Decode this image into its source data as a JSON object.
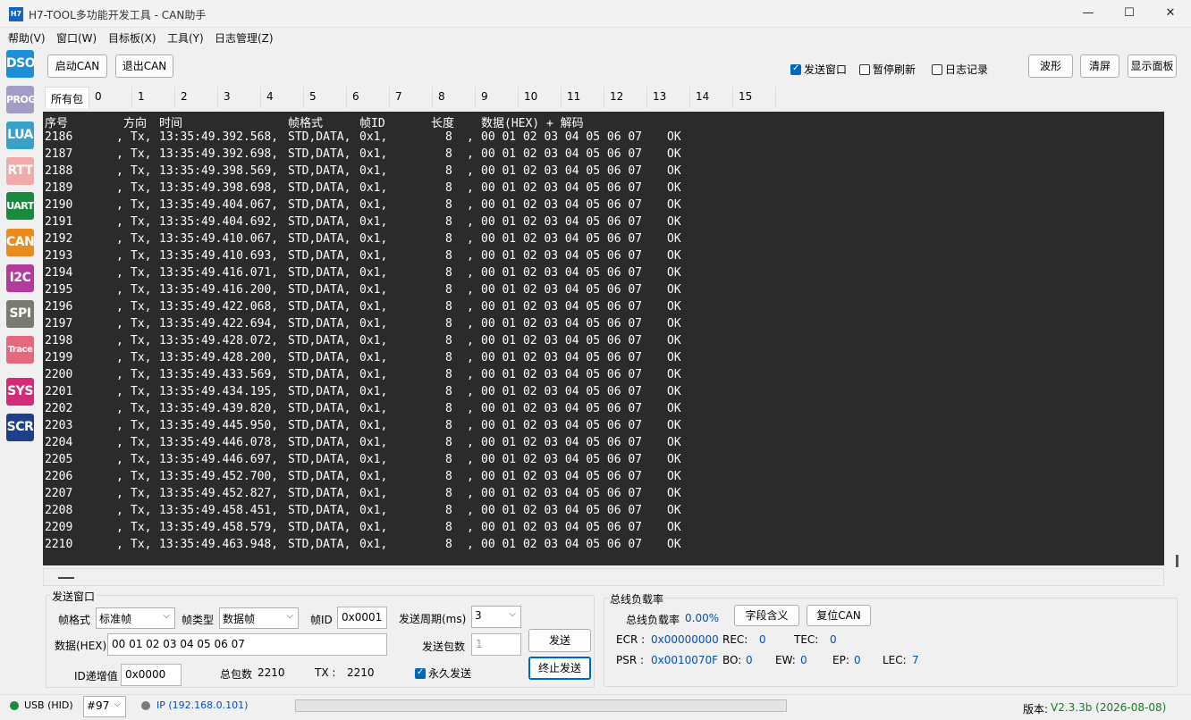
{
  "window": {
    "icon_text": "H7",
    "title": "H7-TOOL多功能开发工具 - CAN助手",
    "minimize": "—",
    "maximize": "☐",
    "close": "✕"
  },
  "menu": [
    "帮助(V)",
    "窗口(W)",
    "目标板(X)",
    "工具(Y)",
    "日志管理(Z)"
  ],
  "sidebar": [
    {
      "label": "DSO",
      "color": "#1e8fd6"
    },
    {
      "label": "PROG",
      "color": "#a59cc6"
    },
    {
      "label": "LUA",
      "color": "#3aa0c8"
    },
    {
      "label": "RTT",
      "color": "#f1a9a9"
    },
    {
      "label": "UART",
      "color": "#1a8a3e"
    },
    {
      "label": "CAN",
      "color": "#e98c1d"
    },
    {
      "label": "I2C",
      "color": "#b43a9b"
    },
    {
      "label": "SPI",
      "color": "#7a7a72"
    },
    {
      "label": "Trace",
      "color": "#e26a7c"
    },
    {
      "label": "SYS",
      "color": "#d42a7a"
    },
    {
      "label": "SCR",
      "color": "#1e3f8a"
    }
  ],
  "toolbar": {
    "start_can": "启动CAN",
    "exit_can": "退出CAN",
    "send_window": {
      "label": "发送窗口",
      "checked": true
    },
    "pause_refresh": {
      "label": "暂停刷新",
      "checked": false
    },
    "log_record": {
      "label": "日志记录",
      "checked": false
    },
    "waveform": "波形",
    "clear": "清屏",
    "show_panel": "显示面板"
  },
  "tabs": [
    "所有包",
    "0",
    "1",
    "2",
    "3",
    "4",
    "5",
    "6",
    "7",
    "8",
    "9",
    "10",
    "11",
    "12",
    "13",
    "14",
    "15"
  ],
  "log": {
    "header": [
      "序号",
      "方向",
      "时间",
      "帧格式",
      "帧ID",
      "长度",
      "数据(HEX) + 解码"
    ],
    "rows": [
      [
        "2186",
        ",",
        "Tx,",
        "13:35:49.392.568,",
        "STD,DATA,",
        "0x1,",
        "8",
        ",",
        "00 01 02 03 04 05 06 07",
        "OK"
      ],
      [
        "2187",
        ",",
        "Tx,",
        "13:35:49.392.698,",
        "STD,DATA,",
        "0x1,",
        "8",
        ",",
        "00 01 02 03 04 05 06 07",
        "OK"
      ],
      [
        "2188",
        ",",
        "Tx,",
        "13:35:49.398.569,",
        "STD,DATA,",
        "0x1,",
        "8",
        ",",
        "00 01 02 03 04 05 06 07",
        "OK"
      ],
      [
        "2189",
        ",",
        "Tx,",
        "13:35:49.398.698,",
        "STD,DATA,",
        "0x1,",
        "8",
        ",",
        "00 01 02 03 04 05 06 07",
        "OK"
      ],
      [
        "2190",
        ",",
        "Tx,",
        "13:35:49.404.067,",
        "STD,DATA,",
        "0x1,",
        "8",
        ",",
        "00 01 02 03 04 05 06 07",
        "OK"
      ],
      [
        "2191",
        ",",
        "Tx,",
        "13:35:49.404.692,",
        "STD,DATA,",
        "0x1,",
        "8",
        ",",
        "00 01 02 03 04 05 06 07",
        "OK"
      ],
      [
        "2192",
        ",",
        "Tx,",
        "13:35:49.410.067,",
        "STD,DATA,",
        "0x1,",
        "8",
        ",",
        "00 01 02 03 04 05 06 07",
        "OK"
      ],
      [
        "2193",
        ",",
        "Tx,",
        "13:35:49.410.693,",
        "STD,DATA,",
        "0x1,",
        "8",
        ",",
        "00 01 02 03 04 05 06 07",
        "OK"
      ],
      [
        "2194",
        ",",
        "Tx,",
        "13:35:49.416.071,",
        "STD,DATA,",
        "0x1,",
        "8",
        ",",
        "00 01 02 03 04 05 06 07",
        "OK"
      ],
      [
        "2195",
        ",",
        "Tx,",
        "13:35:49.416.200,",
        "STD,DATA,",
        "0x1,",
        "8",
        ",",
        "00 01 02 03 04 05 06 07",
        "OK"
      ],
      [
        "2196",
        ",",
        "Tx,",
        "13:35:49.422.068,",
        "STD,DATA,",
        "0x1,",
        "8",
        ",",
        "00 01 02 03 04 05 06 07",
        "OK"
      ],
      [
        "2197",
        ",",
        "Tx,",
        "13:35:49.422.694,",
        "STD,DATA,",
        "0x1,",
        "8",
        ",",
        "00 01 02 03 04 05 06 07",
        "OK"
      ],
      [
        "2198",
        ",",
        "Tx,",
        "13:35:49.428.072,",
        "STD,DATA,",
        "0x1,",
        "8",
        ",",
        "00 01 02 03 04 05 06 07",
        "OK"
      ],
      [
        "2199",
        ",",
        "Tx,",
        "13:35:49.428.200,",
        "STD,DATA,",
        "0x1,",
        "8",
        ",",
        "00 01 02 03 04 05 06 07",
        "OK"
      ],
      [
        "2200",
        ",",
        "Tx,",
        "13:35:49.433.569,",
        "STD,DATA,",
        "0x1,",
        "8",
        ",",
        "00 01 02 03 04 05 06 07",
        "OK"
      ],
      [
        "2201",
        ",",
        "Tx,",
        "13:35:49.434.195,",
        "STD,DATA,",
        "0x1,",
        "8",
        ",",
        "00 01 02 03 04 05 06 07",
        "OK"
      ],
      [
        "2202",
        ",",
        "Tx,",
        "13:35:49.439.820,",
        "STD,DATA,",
        "0x1,",
        "8",
        ",",
        "00 01 02 03 04 05 06 07",
        "OK"
      ],
      [
        "2203",
        ",",
        "Tx,",
        "13:35:49.445.950,",
        "STD,DATA,",
        "0x1,",
        "8",
        ",",
        "00 01 02 03 04 05 06 07",
        "OK"
      ],
      [
        "2204",
        ",",
        "Tx,",
        "13:35:49.446.078,",
        "STD,DATA,",
        "0x1,",
        "8",
        ",",
        "00 01 02 03 04 05 06 07",
        "OK"
      ],
      [
        "2205",
        ",",
        "Tx,",
        "13:35:49.446.697,",
        "STD,DATA,",
        "0x1,",
        "8",
        ",",
        "00 01 02 03 04 05 06 07",
        "OK"
      ],
      [
        "2206",
        ",",
        "Tx,",
        "13:35:49.452.700,",
        "STD,DATA,",
        "0x1,",
        "8",
        ",",
        "00 01 02 03 04 05 06 07",
        "OK"
      ],
      [
        "2207",
        ",",
        "Tx,",
        "13:35:49.452.827,",
        "STD,DATA,",
        "0x1,",
        "8",
        ",",
        "00 01 02 03 04 05 06 07",
        "OK"
      ],
      [
        "2208",
        ",",
        "Tx,",
        "13:35:49.458.451,",
        "STD,DATA,",
        "0x1,",
        "8",
        ",",
        "00 01 02 03 04 05 06 07",
        "OK"
      ],
      [
        "2209",
        ",",
        "Tx,",
        "13:35:49.458.579,",
        "STD,DATA,",
        "0x1,",
        "8",
        ",",
        "00 01 02 03 04 05 06 07",
        "OK"
      ],
      [
        "2210",
        ",",
        "Tx,",
        "13:35:49.463.948,",
        "STD,DATA,",
        "0x1,",
        "8",
        ",",
        "00 01 02 03 04 05 06 07",
        "OK"
      ]
    ]
  },
  "send": {
    "group_title": "发送窗口",
    "frame_format_label": "帧格式",
    "frame_format_value": "标准帧",
    "frame_type_label": "帧类型",
    "frame_type_value": "数据帧",
    "frame_id_label": "帧ID",
    "frame_id_value": "0x0001",
    "period_label": "发送周期(ms)",
    "period_value": "3",
    "data_label": "数据(HEX)",
    "data_value": "00 01 02 03 04 05 06 07",
    "count_label": "发送包数",
    "count_value": "1",
    "send_button": "发送",
    "stop_button": "终止发送",
    "id_inc_label": "ID递增值",
    "id_inc_value": "0x0000",
    "total_label": "总包数",
    "total_value": "2210",
    "tx_label": "TX :",
    "tx_value": "2210",
    "forever_label": "永久发送",
    "forever_checked": true
  },
  "bus": {
    "group_title": "总线负载率",
    "load_label": "总线负载率",
    "load_value": "0.00%",
    "field_meaning_button": "字段含义",
    "reset_can_button": "复位CAN",
    "ecr_label": "ECR :",
    "ecr_value": "0x00000000",
    "rec_label": "REC:",
    "rec_value": "0",
    "tec_label": "TEC:",
    "tec_value": "0",
    "psr_label": "PSR :",
    "psr_value": "0x0010070F",
    "bo_label": "BO:",
    "bo_value": "0",
    "ew_label": "EW:",
    "ew_value": "0",
    "ep_label": "EP:",
    "ep_value": "0",
    "lec_label": "LEC:",
    "lec_value": "7"
  },
  "status": {
    "usb_label": "USB (HID)",
    "usb_color": "#1a8a3e",
    "device_value": "#97",
    "ip_label": "IP (192.168.0.101)",
    "ip_color": "#7a7a7a",
    "version_label": "版本:",
    "version_value": "V2.3.3b (2026-08-08)"
  }
}
